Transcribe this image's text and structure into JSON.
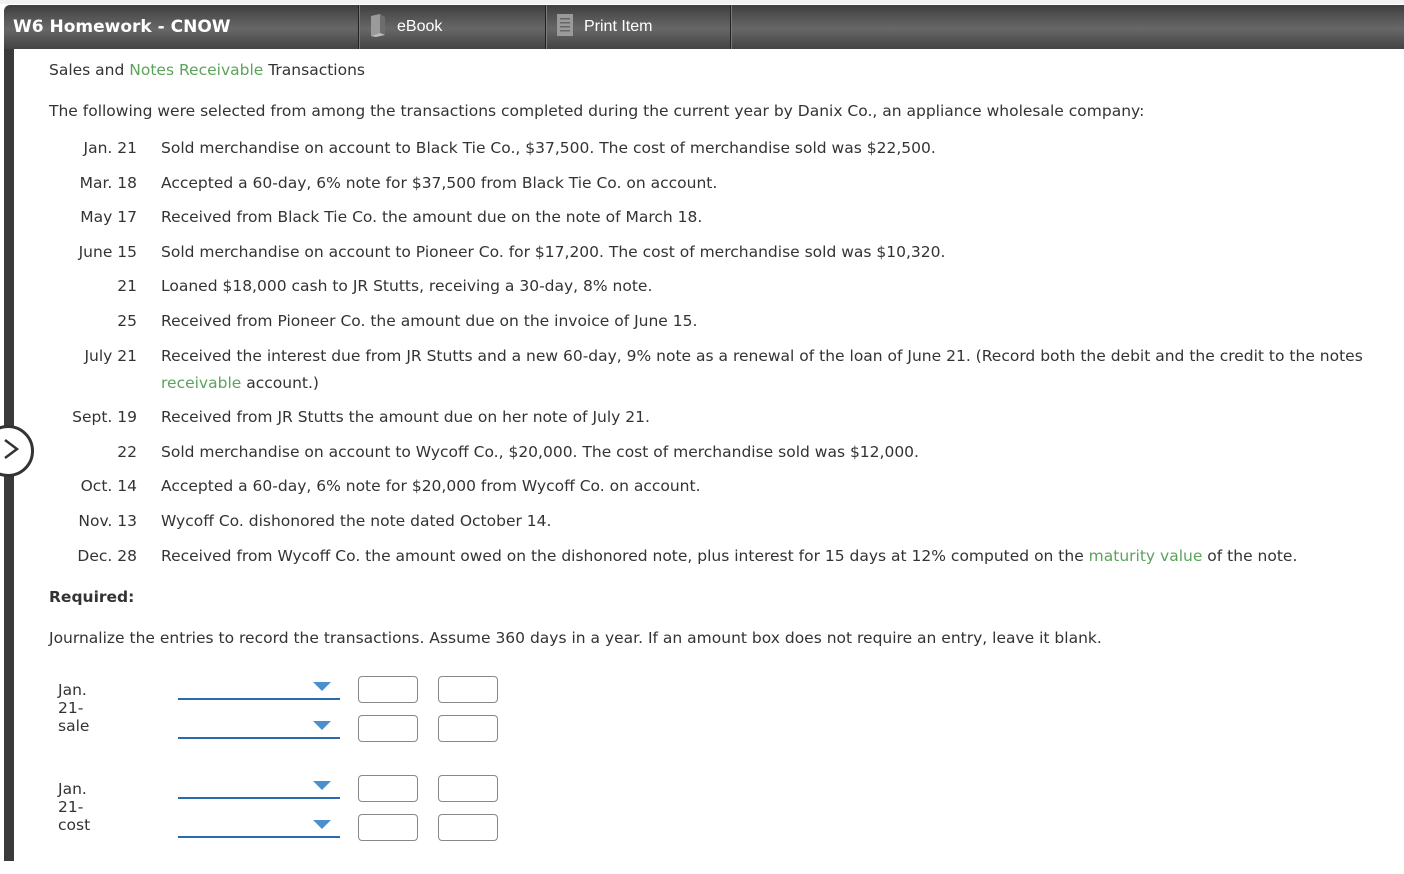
{
  "toolbar": {
    "title": "W6 Homework - CNOW",
    "ebook_label": "eBook",
    "print_label": "Print Item"
  },
  "heading": {
    "part1": "Sales and ",
    "link": "Notes Receivable",
    "part2": " Transactions"
  },
  "intro": "The following were selected from among the transactions completed during the current year by Danix Co., an appliance wholesale company:",
  "transactions": [
    {
      "date": "Jan. 21",
      "text": "Sold merchandise on account to Black Tie Co., $37,500. The cost of merchandise sold was $22,500."
    },
    {
      "date": "Mar. 18",
      "text": "Accepted a 60-day, 6% note for $37,500 from Black Tie Co. on account."
    },
    {
      "date": "May 17",
      "text": "Received from Black Tie Co. the amount due on the note of March 18."
    },
    {
      "date": "June 15",
      "text": "Sold merchandise on account to Pioneer Co. for $17,200. The cost of merchandise sold was $10,320."
    },
    {
      "date": "21",
      "text": "Loaned $18,000 cash to JR Stutts, receiving a 30-day, 8% note."
    },
    {
      "date": "25",
      "text": "Received from Pioneer Co. the amount due on the invoice of June 15."
    },
    {
      "date": "July 21",
      "text_a": "Received the interest due from JR Stutts and a new 60-day, 9% note as a renewal of the loan of June 21. (Record both the debit and the credit to the notes ",
      "link": "receivable",
      "text_b": " account.)"
    },
    {
      "date": "Sept. 19",
      "text": "Received from JR Stutts the amount due on her note of July 21."
    },
    {
      "date": "22",
      "text": "Sold merchandise on account to Wycoff Co., $20,000. The cost of merchandise sold was $12,000."
    },
    {
      "date": "Oct. 14",
      "text": "Accepted a 60-day, 6% note for $20,000 from Wycoff Co. on account."
    },
    {
      "date": "Nov. 13",
      "text": "Wycoff Co. dishonored the note dated October 14."
    },
    {
      "date": "Dec. 28",
      "text_a": "Received from Wycoff Co. the amount owed on the dishonored note, plus interest for 15 days at 12% computed on the ",
      "link": "maturity value",
      "text_b": " of the note."
    }
  ],
  "required_label": "Required:",
  "instructions": "Journalize the entries to record the transactions. Assume 360 days in a year. If an amount box does not require an entry, leave it blank.",
  "journal": [
    {
      "label": "Jan. 21-sale",
      "rows": [
        {
          "account": "",
          "debit": "",
          "credit": ""
        },
        {
          "account": "",
          "debit": "",
          "credit": ""
        }
      ]
    },
    {
      "label": "Jan. 21-cost",
      "rows": [
        {
          "account": "",
          "debit": "",
          "credit": ""
        },
        {
          "account": "",
          "debit": "",
          "credit": ""
        }
      ]
    }
  ],
  "colors": {
    "link_green": "#5ba35b",
    "select_blue": "#2a6bb0"
  }
}
